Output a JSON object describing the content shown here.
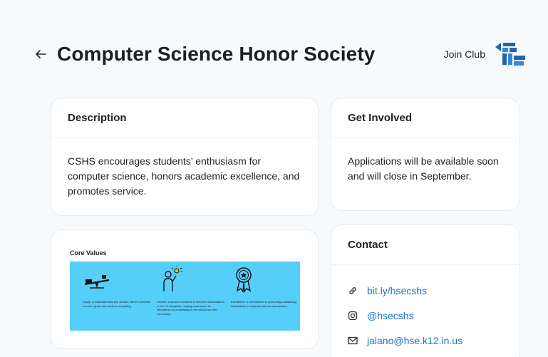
{
  "header": {
    "title": "Computer Science Honor Society",
    "join_label": "Join Club"
  },
  "description": {
    "heading": "Description",
    "text": "CSHS encourages students’ enthusiasm for computer science, honors academic excellence, and promotes service."
  },
  "get_involved": {
    "heading": "Get Involved",
    "text": "Applications will be available soon and will close in September."
  },
  "core_values": {
    "title": "Core Values",
    "items": [
      {
        "icon": "seesaw-icon",
        "text": "Equity: A realization that any student has the potential to excel, grow, and excel in computing."
      },
      {
        "icon": "person-idea-icon",
        "text": "Service: empower members to become ambassadors of the CS discipline, helping underscore its importance as a necessity in the school and the community."
      },
      {
        "icon": "award-medal-icon",
        "text": "Excellence: A commitment to promoting outstanding scholarship in computer science coursework."
      }
    ],
    "band_color": "#55cffa"
  },
  "contact": {
    "heading": "Contact",
    "items": [
      {
        "icon": "link-icon",
        "text": "bit.ly/hsecshs"
      },
      {
        "icon": "instagram-icon",
        "text": "@hsecshs"
      },
      {
        "icon": "mail-icon",
        "text": "jalano@hse.k12.in.us"
      }
    ],
    "link_color": "#1a73d6"
  }
}
